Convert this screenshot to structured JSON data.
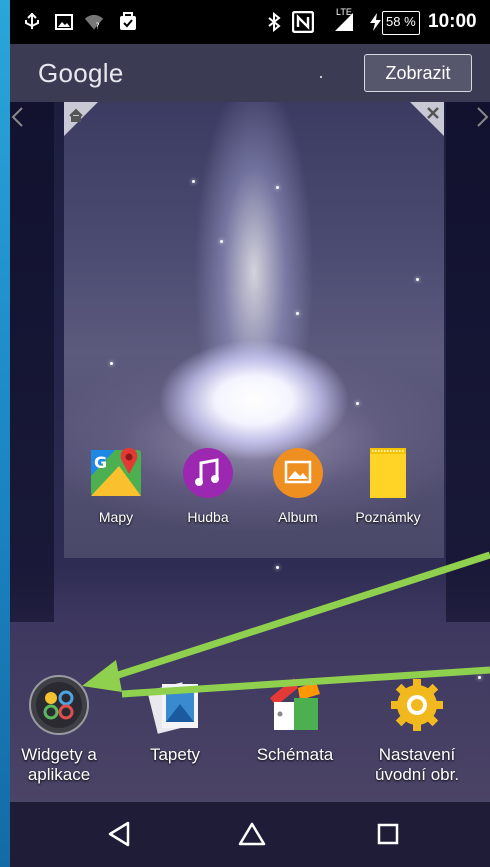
{
  "status_bar": {
    "battery_percent": "58 %",
    "time": "10:00",
    "network_label": "LTE",
    "icons": [
      "usb-icon",
      "image-notification-icon",
      "wifi-icon",
      "download-icon",
      "bluetooth-icon",
      "nfc-icon",
      "signal-icon",
      "charging-icon",
      "battery-icon"
    ]
  },
  "search_bar": {
    "logo_text": "Google",
    "button_label": "Zobrazit"
  },
  "home_page_card": {
    "icons": [
      "home-icon",
      "close-icon"
    ],
    "apps": [
      {
        "label": "Mapy",
        "icon": "maps-icon"
      },
      {
        "label": "Hudba",
        "icon": "music-icon"
      },
      {
        "label": "Album",
        "icon": "album-icon"
      },
      {
        "label": "Poznámky",
        "icon": "notes-icon"
      }
    ]
  },
  "dock": {
    "items": [
      {
        "line1": "Widgety a",
        "line2": "aplikace",
        "icon": "widgets-apps-icon"
      },
      {
        "line1": "Tapety",
        "line2": "",
        "icon": "wallpapers-icon"
      },
      {
        "line1": "Schémata",
        "line2": "",
        "icon": "themes-icon"
      },
      {
        "line1": "Nastavení",
        "line2": "úvodní obr.",
        "icon": "settings-gear-icon"
      }
    ]
  },
  "nav_bar": {
    "buttons": [
      "back-icon",
      "home-icon",
      "recents-icon"
    ]
  },
  "colors": {
    "frame_blue": "#1b86c4",
    "status_bar": "#000000",
    "search_bar": "#3e3e56",
    "annotation_arrow": "#8fd14f"
  }
}
